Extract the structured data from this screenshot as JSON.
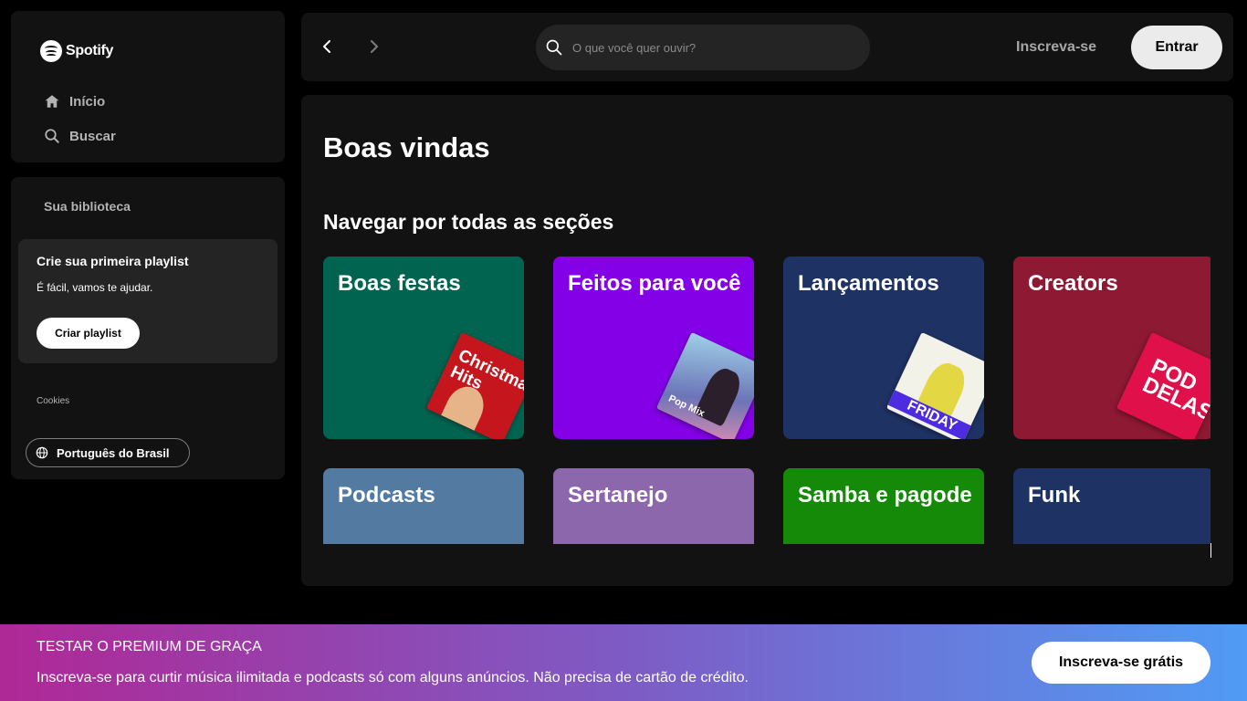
{
  "sidebar": {
    "logo_text": "Spotify",
    "nav": [
      {
        "label": "Início",
        "icon": "home-icon"
      },
      {
        "label": "Buscar",
        "icon": "search-icon"
      }
    ],
    "library": {
      "title": "Sua biblioteca",
      "card": {
        "title": "Crie sua primeira playlist",
        "subtitle": "É fácil, vamos te ajudar.",
        "button": "Criar playlist"
      },
      "cookies": "Cookies",
      "language": "Português do Brasil"
    }
  },
  "topbar": {
    "search_placeholder": "O que você quer ouvir?",
    "signup": "Inscreva-se",
    "login": "Entrar"
  },
  "main": {
    "welcome": "Boas vindas",
    "section_title": "Navegar por todas as seções",
    "cards": [
      {
        "title": "Boas festas",
        "color": "#006450",
        "art_text": "Christmas Hits",
        "art_color": "#c4161c"
      },
      {
        "title": "Feitos para você",
        "color": "#8400e7",
        "art_text": "Pop Mix",
        "art_color": "#7d8fc0"
      },
      {
        "title": "Lançamentos",
        "color": "#1e3264",
        "art_text": "FRIDAY",
        "art_color": "#e8e04a"
      },
      {
        "title": "Creators",
        "color": "#8d1932",
        "art_text": "POD DELAS",
        "art_color": "#e0114a"
      },
      {
        "title": "Podcasts",
        "color": "#537aa1",
        "art_text": "",
        "art_color": ""
      },
      {
        "title": "Sertanejo",
        "color": "#8d67ab",
        "art_text": "",
        "art_color": ""
      },
      {
        "title": "Samba e pagode",
        "color": "#148a08",
        "art_text": "",
        "art_color": ""
      },
      {
        "title": "Funk",
        "color": "#1e3264",
        "art_text": "",
        "art_color": ""
      }
    ]
  },
  "banner": {
    "title": "TESTAR O PREMIUM DE GRAÇA",
    "subtitle": "Inscreva-se para curtir música ilimitada e podcasts só com alguns anúncios. Não precisa de cartão de crédito.",
    "button": "Inscreva-se grátis"
  },
  "colors": {
    "background": "#000000",
    "panel": "#121212",
    "banner_start": "#af2896",
    "banner_end": "#509bf5"
  }
}
